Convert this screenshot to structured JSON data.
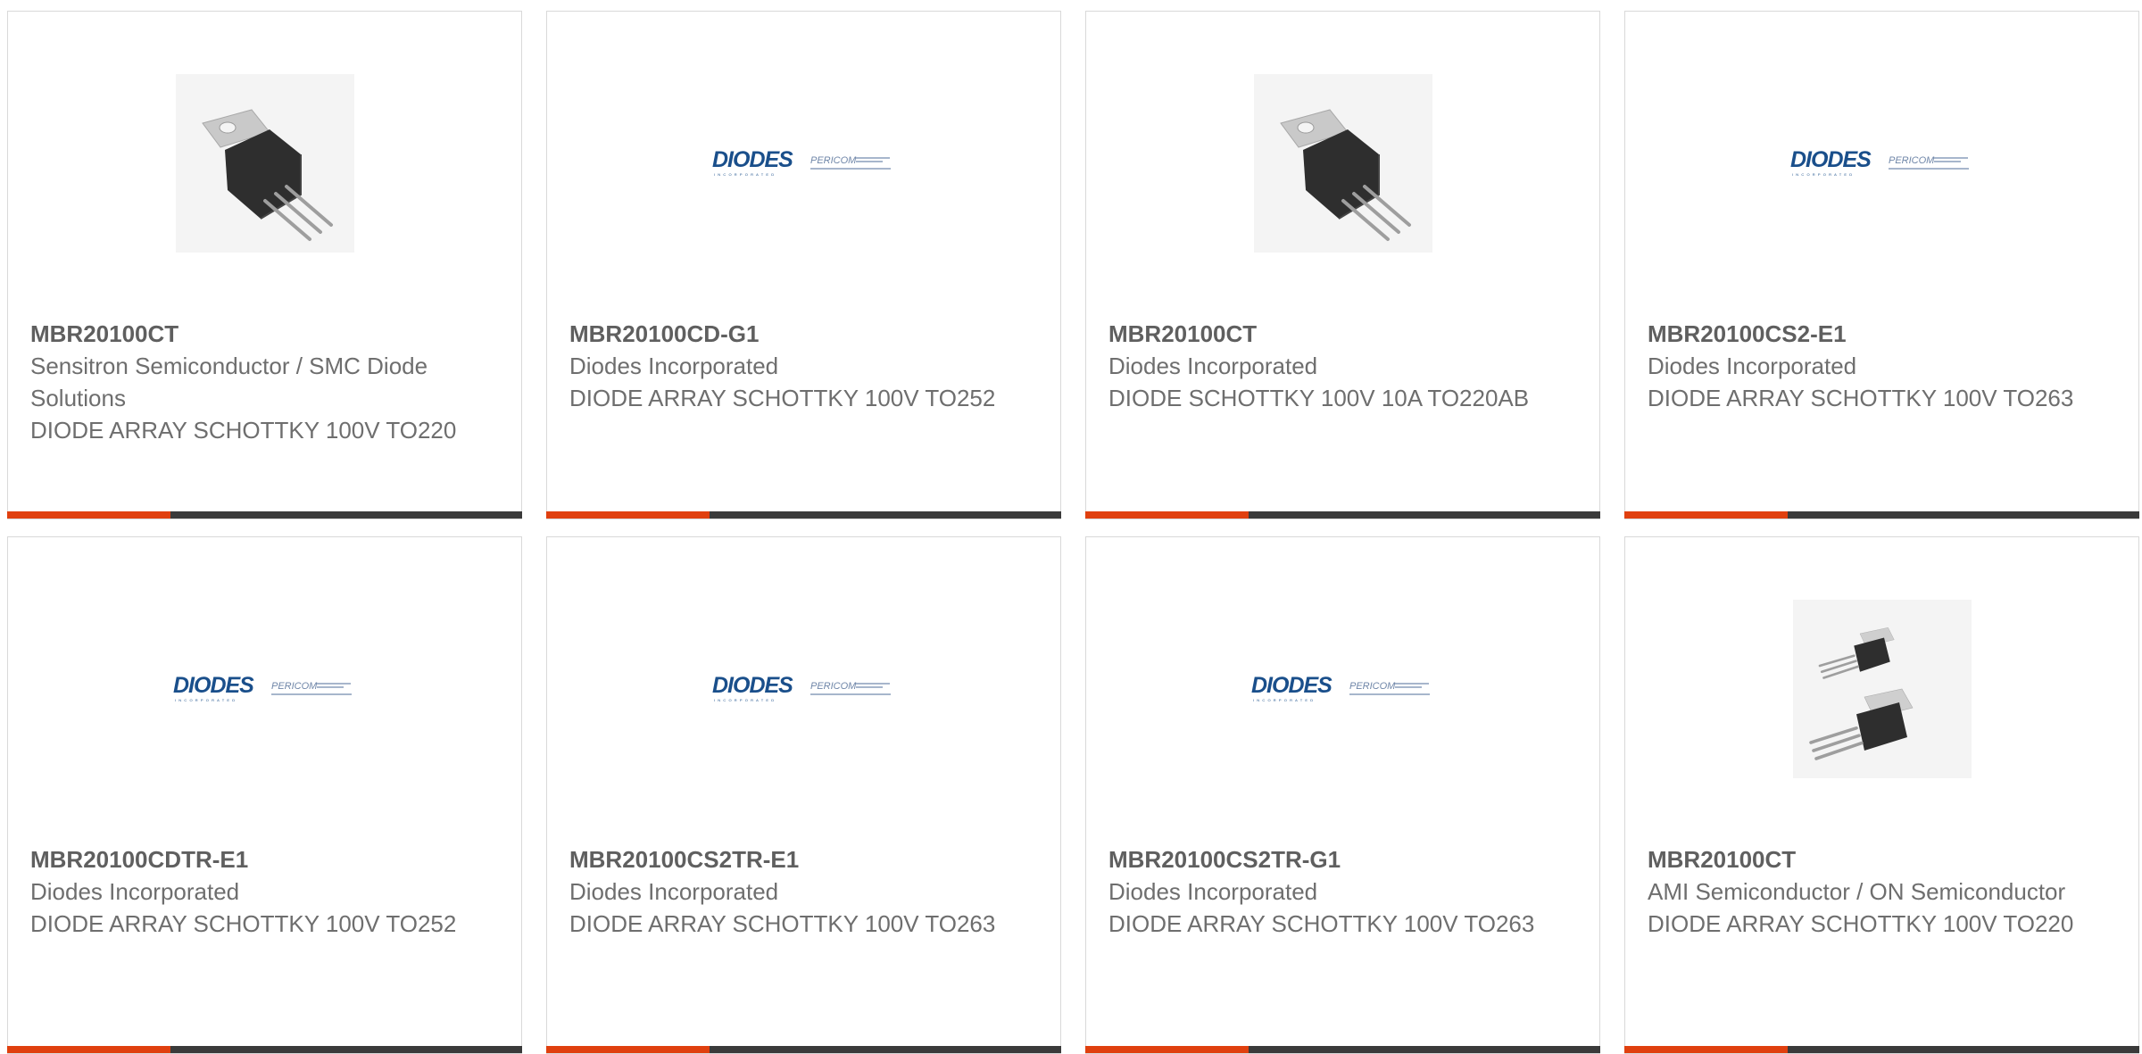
{
  "colors": {
    "accent": "#e0400f",
    "bar": "#3a3a3a",
    "border": "#d9d9d9",
    "part_number_text": "#5f5f5f",
    "body_text": "#6e6e6e",
    "diodes_logo_blue": "#1a4f8b"
  },
  "products": [
    {
      "part_number": "MBR20100CT",
      "manufacturer": "Sensitron Semiconductor / SMC Diode Solutions",
      "description": "DIODE ARRAY SCHOTTKY 100V TO220",
      "image": "to220-transistor-icon"
    },
    {
      "part_number": "MBR20100CD-G1",
      "manufacturer": "Diodes Incorporated",
      "description": "DIODE ARRAY SCHOTTKY 100V TO252",
      "image": "diodes-pericom-logo"
    },
    {
      "part_number": "MBR20100CT",
      "manufacturer": "Diodes Incorporated",
      "description": "DIODE SCHOTTKY 100V 10A TO220AB",
      "image": "to220-transistor-icon"
    },
    {
      "part_number": "MBR20100CS2-E1",
      "manufacturer": "Diodes Incorporated",
      "description": "DIODE ARRAY SCHOTTKY 100V TO263",
      "image": "diodes-pericom-logo"
    },
    {
      "part_number": "MBR20100CDTR-E1",
      "manufacturer": "Diodes Incorporated",
      "description": "DIODE ARRAY SCHOTTKY 100V TO252",
      "image": "diodes-pericom-logo"
    },
    {
      "part_number": "MBR20100CS2TR-E1",
      "manufacturer": "Diodes Incorporated",
      "description": "DIODE ARRAY SCHOTTKY 100V TO263",
      "image": "diodes-pericom-logo"
    },
    {
      "part_number": "MBR20100CS2TR-G1",
      "manufacturer": "Diodes Incorporated",
      "description": "DIODE ARRAY SCHOTTKY 100V TO263",
      "image": "diodes-pericom-logo"
    },
    {
      "part_number": "MBR20100CT",
      "manufacturer": "AMI Semiconductor / ON Semiconductor",
      "description": "DIODE ARRAY SCHOTTKY 100V TO220",
      "image": "dual-to220-transistor-icon"
    }
  ],
  "logo": {
    "brand": "DIODES",
    "sub_brand": "PERICOM"
  }
}
